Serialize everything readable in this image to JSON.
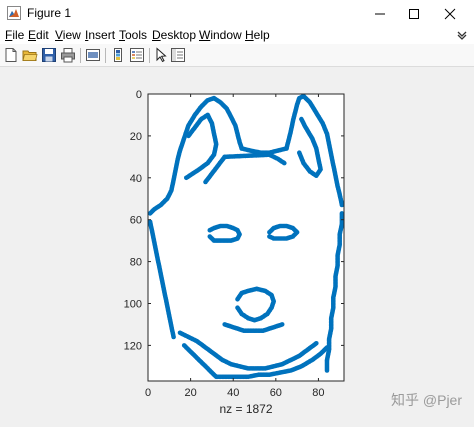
{
  "window": {
    "title": "Figure 1",
    "controls": {
      "minimize": "–",
      "maximize": "☐",
      "close": "✕"
    }
  },
  "menu": {
    "items": [
      {
        "key": "F",
        "rest": "ile"
      },
      {
        "key": "E",
        "rest": "dit"
      },
      {
        "key": "V",
        "rest": "iew"
      },
      {
        "key": "I",
        "rest": "nsert"
      },
      {
        "key": "T",
        "rest": "ools"
      },
      {
        "key": "D",
        "rest": "esktop"
      },
      {
        "key": "W",
        "rest": "indow"
      },
      {
        "key": "H",
        "rest": "elp"
      }
    ]
  },
  "toolbar": {
    "icons": [
      "new-figure-icon",
      "open-file-icon",
      "save-icon",
      "print-icon",
      "link-plot-icon",
      "insert-colorbar-icon",
      "insert-legend-icon",
      "edit-plot-arrow-icon",
      "property-inspector-icon"
    ]
  },
  "plot": {
    "xlabel": "nz = 1872",
    "marker_color": "#0072BD",
    "xlim": [
      0,
      92
    ],
    "ylim": [
      0,
      137
    ],
    "y_reversed": true,
    "xticks": [
      "0",
      "20",
      "40",
      "60",
      "80"
    ],
    "yticks": [
      "0",
      "20",
      "40",
      "60",
      "80",
      "100",
      "120"
    ]
  },
  "chart_data": {
    "type": "scatter",
    "subtype": "spy sparsity pattern",
    "nz": 1872,
    "xlabel": "nz = 1872",
    "xlim": [
      0,
      92
    ],
    "ylim": [
      0,
      137
    ],
    "y_reversed": true,
    "xticks": [
      0,
      20,
      40,
      60,
      80
    ],
    "yticks": [
      0,
      20,
      40,
      60,
      80,
      100,
      120
    ],
    "marker_color": "#0072BD",
    "strokes": [
      {
        "part": "head-left-edge",
        "points": [
          [
            1,
            57
          ],
          [
            3,
            55
          ],
          [
            6,
            53
          ],
          [
            9,
            50
          ],
          [
            11,
            46
          ],
          [
            12,
            41
          ],
          [
            13,
            36
          ],
          [
            14,
            31
          ],
          [
            15,
            27
          ],
          [
            17,
            21
          ],
          [
            19,
            15
          ],
          [
            22,
            10
          ],
          [
            25,
            6
          ],
          [
            28,
            3
          ],
          [
            31,
            2
          ]
        ]
      },
      {
        "part": "left-ear-inner-edge",
        "points": [
          [
            31,
            2
          ],
          [
            34,
            4
          ],
          [
            37,
            7
          ],
          [
            39,
            11
          ],
          [
            41,
            15
          ],
          [
            42,
            19
          ],
          [
            43,
            23
          ],
          [
            44,
            26
          ]
        ]
      },
      {
        "part": "forehead-edge",
        "points": [
          [
            44,
            26
          ],
          [
            48,
            27
          ],
          [
            53,
            28
          ],
          [
            57,
            28
          ],
          [
            61,
            27
          ],
          [
            65,
            26
          ]
        ]
      },
      {
        "part": "right-ear-inner-edge",
        "points": [
          [
            65,
            26
          ],
          [
            66,
            22
          ],
          [
            67,
            18
          ],
          [
            68,
            13
          ],
          [
            69,
            9
          ],
          [
            70,
            5
          ],
          [
            71,
            2
          ],
          [
            73,
            1
          ]
        ]
      },
      {
        "part": "head-right-edge",
        "points": [
          [
            73,
            1
          ],
          [
            76,
            4
          ],
          [
            79,
            9
          ],
          [
            82,
            14
          ],
          [
            84,
            19
          ],
          [
            85,
            24
          ],
          [
            86,
            29
          ],
          [
            87,
            34
          ],
          [
            88,
            39
          ],
          [
            89,
            44
          ],
          [
            90,
            48
          ],
          [
            91,
            53
          ]
        ]
      },
      {
        "part": "left-ear-inner-fold",
        "points": [
          [
            19,
            20
          ],
          [
            22,
            16
          ],
          [
            25,
            12
          ],
          [
            28,
            10
          ],
          [
            30,
            14
          ],
          [
            31,
            19
          ],
          [
            32,
            24
          ],
          [
            31,
            29
          ],
          [
            28,
            33
          ],
          [
            24,
            36
          ],
          [
            21,
            38
          ],
          [
            18,
            40
          ]
        ]
      },
      {
        "part": "right-ear-inner-fold",
        "points": [
          [
            72,
            12
          ],
          [
            74,
            16
          ],
          [
            77,
            21
          ],
          [
            79,
            26
          ],
          [
            80,
            31
          ],
          [
            81,
            36
          ],
          [
            79,
            39
          ],
          [
            76,
            37
          ],
          [
            73,
            33
          ],
          [
            71,
            28
          ]
        ]
      },
      {
        "part": "forehead-inner-marks",
        "points": [
          [
            27,
            42
          ],
          [
            30,
            38
          ],
          [
            33,
            34
          ],
          [
            36,
            30
          ],
          [
            57,
            29
          ],
          [
            61,
            31
          ],
          [
            64,
            33
          ]
        ]
      },
      {
        "part": "left-cheek-edge",
        "points": [
          [
            1,
            61
          ],
          [
            2,
            66
          ],
          [
            3,
            71
          ],
          [
            4,
            76
          ],
          [
            5,
            81
          ],
          [
            6,
            86
          ],
          [
            7,
            91
          ],
          [
            8,
            96
          ],
          [
            9,
            101
          ],
          [
            10,
            106
          ],
          [
            11,
            111
          ],
          [
            12,
            116
          ]
        ]
      },
      {
        "part": "right-cheek-edge",
        "points": [
          [
            91,
            57
          ],
          [
            91,
            62
          ],
          [
            90,
            67
          ],
          [
            90,
            72
          ],
          [
            89,
            77
          ],
          [
            89,
            82
          ],
          [
            88,
            87
          ],
          [
            88,
            92
          ],
          [
            87,
            97
          ],
          [
            87,
            102
          ],
          [
            86,
            107
          ],
          [
            86,
            112
          ],
          [
            85,
            117
          ],
          [
            85,
            122
          ],
          [
            84,
            127
          ],
          [
            84,
            132
          ]
        ]
      },
      {
        "part": "left-eye",
        "points": [
          [
            29,
            65
          ],
          [
            31,
            64
          ],
          [
            34,
            63
          ],
          [
            37,
            63
          ],
          [
            40,
            64
          ],
          [
            42,
            65
          ],
          [
            43,
            67
          ],
          [
            42,
            69
          ],
          [
            39,
            70
          ],
          [
            35,
            70
          ],
          [
            31,
            70
          ],
          [
            29,
            68
          ]
        ]
      },
      {
        "part": "right-eye",
        "points": [
          [
            57,
            66
          ],
          [
            59,
            64
          ],
          [
            62,
            63
          ],
          [
            65,
            63
          ],
          [
            68,
            64
          ],
          [
            70,
            66
          ],
          [
            68,
            68
          ],
          [
            65,
            69
          ],
          [
            62,
            69
          ],
          [
            59,
            69
          ],
          [
            57,
            68
          ]
        ]
      },
      {
        "part": "nose",
        "points": [
          [
            42,
            98
          ],
          [
            44,
            95
          ],
          [
            47,
            94
          ],
          [
            51,
            93
          ],
          [
            55,
            94
          ],
          [
            58,
            96
          ],
          [
            59,
            99
          ],
          [
            58,
            102
          ],
          [
            56,
            105
          ],
          [
            53,
            107
          ],
          [
            50,
            108
          ],
          [
            47,
            107
          ],
          [
            44,
            105
          ],
          [
            42,
            102
          ]
        ]
      },
      {
        "part": "mouth",
        "points": [
          [
            36,
            110
          ],
          [
            39,
            111
          ],
          [
            42,
            112
          ],
          [
            45,
            113
          ],
          [
            48,
            113
          ],
          [
            51,
            113
          ],
          [
            54,
            113
          ],
          [
            57,
            112
          ],
          [
            60,
            111
          ],
          [
            63,
            110
          ]
        ]
      },
      {
        "part": "jaw-line",
        "points": [
          [
            15,
            114
          ],
          [
            19,
            116
          ],
          [
            23,
            118
          ],
          [
            27,
            121
          ],
          [
            31,
            124
          ],
          [
            35,
            127
          ],
          [
            39,
            129
          ],
          [
            43,
            130
          ],
          [
            47,
            131
          ],
          [
            51,
            131
          ],
          [
            55,
            131
          ],
          [
            59,
            130
          ],
          [
            63,
            129
          ],
          [
            67,
            127
          ],
          [
            71,
            125
          ],
          [
            75,
            122
          ],
          [
            79,
            119
          ]
        ]
      },
      {
        "part": "chin-fill",
        "points": [
          [
            17,
            120
          ],
          [
            20,
            123
          ],
          [
            23,
            126
          ],
          [
            26,
            129
          ],
          [
            29,
            132
          ],
          [
            32,
            135
          ],
          [
            37,
            135
          ],
          [
            42,
            135
          ],
          [
            47,
            135
          ],
          [
            52,
            134
          ],
          [
            57,
            134
          ],
          [
            62,
            133
          ],
          [
            67,
            132
          ],
          [
            72,
            130
          ],
          [
            77,
            127
          ],
          [
            81,
            124
          ],
          [
            84,
            121
          ]
        ]
      }
    ]
  },
  "watermark": "知乎 @Pjer"
}
